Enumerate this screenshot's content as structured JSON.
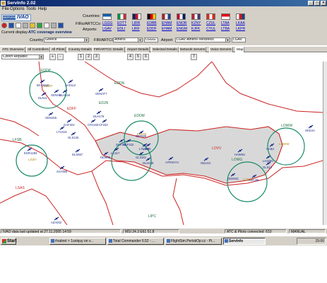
{
  "window": {
    "title": "ServInfo 2.02"
  },
  "menu": [
    "File",
    "Options",
    "Tools",
    "Help"
  ],
  "toolbar": {
    "logo_left": "SERVINFO",
    "logo_right": "IVAO",
    "current_display_label": "Current display",
    "current_display_value": "ATC coverage overview",
    "country_label": "Country",
    "country_value": "Greece",
    "fir_label": "FIR/ARTCC",
    "fir_value": "Athens",
    "fir_code": "LGGG",
    "airport_label": "Airport",
    "airport_value": "LGAV Athens-Venizelos",
    "airport_code": "LGAV",
    "countries_label": "Countries:",
    "firs_label": "FIRs/ARTCCs:",
    "airports_label": "Airports:",
    "flags": [
      {
        "name": "Greece",
        "fir": "LGGG",
        "airport": "LGAV",
        "colors": [
          "#0d5eaf",
          "#ffffff"
        ]
      },
      {
        "name": "Italy",
        "fir": "EDTT",
        "airport": "EDLI",
        "colors": [
          "#009246",
          "#ffffff",
          "#ce2b37"
        ]
      },
      {
        "name": "United Kingdom",
        "fir": "LIRR",
        "airport": "LIRF",
        "colors": [
          "#012169",
          "#c8102e",
          "#ffffff"
        ]
      },
      {
        "name": "Germany",
        "fir": "EDBB",
        "airport": "EDDF",
        "colors": [
          "#000000",
          "#dd0000",
          "#ffce00"
        ]
      },
      {
        "name": "Netherlands",
        "fir": "EHAM",
        "airport": "EHAM",
        "colors": [
          "#ae1c28",
          "#ffffff",
          "#21468b"
        ]
      },
      {
        "name": "Norway",
        "fir": "ENOR",
        "airport": "ENGM",
        "colors": [
          "#ba0c2f",
          "#ffffff",
          "#00205b"
        ]
      },
      {
        "name": "USA",
        "fir": "KZNY",
        "airport": "KJFK",
        "colors": [
          "#b22234",
          "#ffffff",
          "#3c3b6e"
        ]
      },
      {
        "name": "Canada",
        "fir": "CZUL",
        "airport": "CYUL",
        "colors": [
          "#d52b1e",
          "#ffffff",
          "#d52b1e"
        ]
      },
      {
        "name": "Turkey",
        "fir": "LTAA",
        "airport": "LTBA",
        "colors": [
          "#e30a17",
          "#ffffff"
        ]
      },
      {
        "name": "Czech Republic",
        "fir": "LKAA",
        "airport": "LKPR",
        "colors": [
          "#ffffff",
          "#d7141a",
          "#11457e"
        ]
      }
    ]
  },
  "tabs": [
    {
      "label": "ATC Overview"
    },
    {
      "label": "All Controllers"
    },
    {
      "label": "All Pilots"
    },
    {
      "label": "Country Details"
    },
    {
      "label": "FIR/ARTCC Details"
    },
    {
      "label": "Airport Details"
    },
    {
      "label": "Selected Details"
    },
    {
      "label": "Network Servers"
    },
    {
      "label": "Voice Servers"
    },
    {
      "label": "Map"
    }
  ],
  "map": {
    "country_select": "Czech Republic",
    "tool_labels": [
      "+",
      "-",
      "1",
      "2",
      "3",
      "4",
      "5",
      "6",
      "7"
    ],
    "colors": {
      "background": "#ffffff",
      "land_shade": "#d8d8d8",
      "border": "#cc2222",
      "coverage": "#1a8a6a",
      "aircraft": "#1a2a8a",
      "text_blue": "#1a2a8a",
      "text_green": "#207040",
      "text_red": "#cc2222"
    },
    "fir_labels": [
      "EDDP",
      "EDDN",
      "EDFF",
      "EDDM",
      "LOVV",
      "LOWW",
      "LFSB",
      "LSAS",
      "LOWG",
      "LIPC",
      "EDJN"
    ],
    "station_labels": [
      "EDDP",
      "EDDM",
      "LOWW",
      "LOWG",
      "LSZH"
    ],
    "callsigns": [
      "SAS112",
      "BCA5110",
      "DLH134",
      "GENS6",
      "DLN11",
      "GEN345",
      "GAF322",
      "LTU415",
      "GLS125",
      "DLS067",
      "DLH176",
      "CPA183",
      "DEM66",
      "LC217",
      "SCF222",
      "LTU206",
      "GL3182",
      "DLH249",
      "AYRSH74",
      "OELKG",
      "HAWK6",
      "LH3280",
      "GLS12",
      "OKDJA",
      "HA6U",
      "OEDMG",
      "AUA38L",
      "SAY085",
      "EGR1283",
      "AZA002",
      "SCF201",
      "GENAT7",
      "CF233",
      "OEDM8",
      "LSGG"
    ]
  },
  "status": {
    "left": "IVAO data last updated at 27.11.2005 14:59",
    "mid": "MSI 24.3  E61 51.8",
    "right1": "ATC & Pilots connected: 610",
    "right2": "MANUAL"
  },
  "taskbar": {
    "start": "Start",
    "tasks": [
      "#vatnet > 1uniquy on v...",
      "Total Commander 6.52 - ...",
      "FlightSim.PeriskOp.cz - Pi...",
      "ServInfo"
    ],
    "clock": "15:00"
  }
}
